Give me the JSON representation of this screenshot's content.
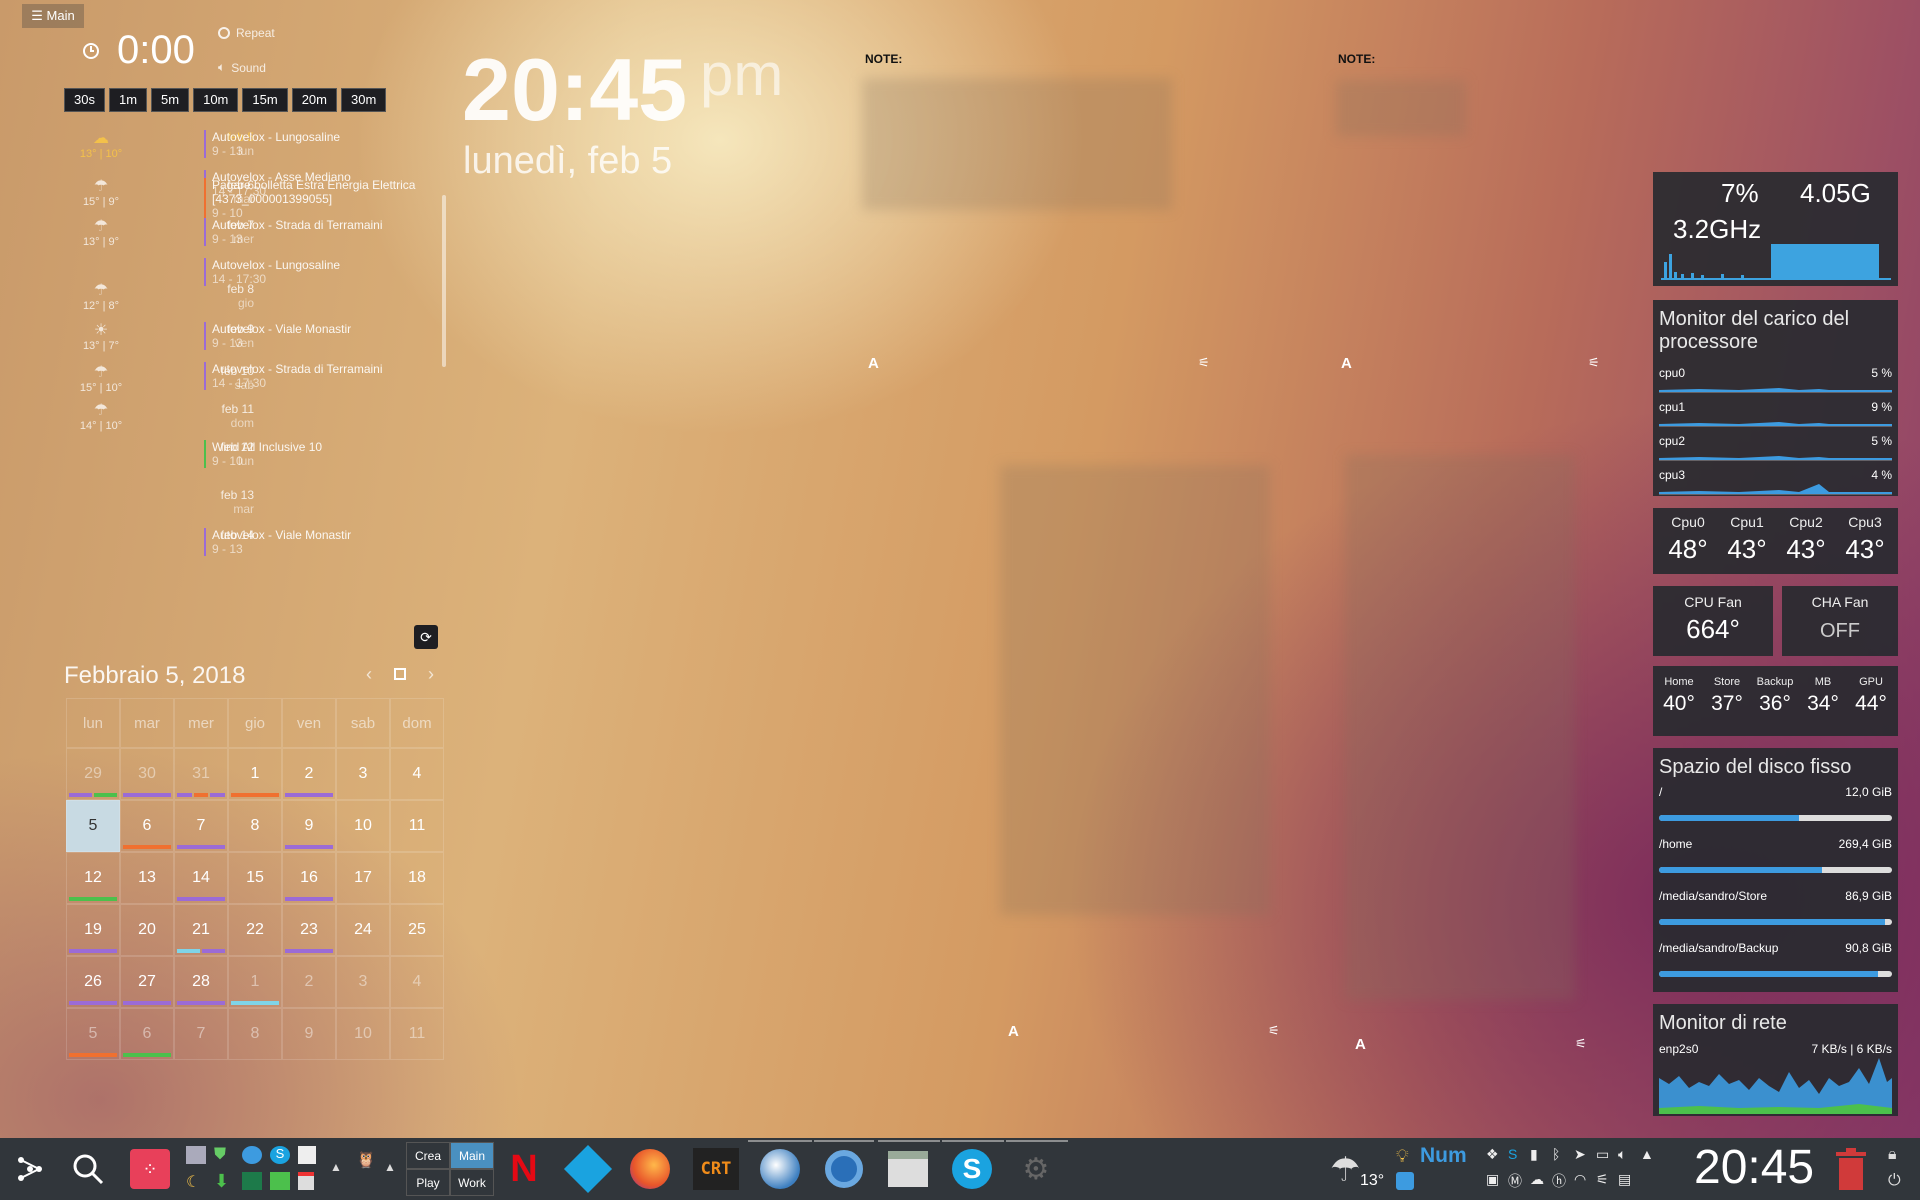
{
  "main_button": {
    "label": "☰ Main"
  },
  "timer": {
    "value": "0:00",
    "repeat_label": "Repeat",
    "sound_label": "Sound",
    "presets": [
      "30s",
      "1m",
      "5m",
      "10m",
      "15m",
      "20m",
      "30m"
    ]
  },
  "agenda": {
    "days": [
      {
        "date": "feb 5",
        "weekday": "lun",
        "weather": "13° | 10°",
        "icon": "cloud",
        "today": true,
        "events": [
          {
            "title": "Autovelox - Lungosaline",
            "time": "9 - 13",
            "color": "#9b6bd6"
          },
          {
            "title": "Autovelox - Asse Mediano",
            "time": "14 - 17:30",
            "color": "#9b6bd6"
          }
        ]
      },
      {
        "date": "feb 6",
        "weekday": "mar",
        "weather": "15° | 9°",
        "icon": "rain",
        "events": [
          {
            "title": "Pagare bolletta Estra Energia Elettrica [4373_000001399055]",
            "time": "9 - 10",
            "color": "#f07030"
          }
        ]
      },
      {
        "date": "feb 7",
        "weekday": "mer",
        "weather": "13° | 9°",
        "icon": "rain",
        "events": [
          {
            "title": "Autovelox - Strada di Terramaini",
            "time": "9 - 13",
            "color": "#9b6bd6"
          },
          {
            "title": "Autovelox - Lungosaline",
            "time": "14 - 17:30",
            "color": "#9b6bd6"
          }
        ]
      },
      {
        "date": "feb 8",
        "weekday": "gio",
        "weather": "12° | 8°",
        "icon": "rain",
        "events": []
      },
      {
        "date": "feb 9",
        "weekday": "ven",
        "weather": "13° | 7°",
        "icon": "sun",
        "events": [
          {
            "title": "Autovelox - Viale Monastir",
            "time": "9 - 13",
            "color": "#9b6bd6"
          },
          {
            "title": "Autovelox - Strada di Terramaini",
            "time": "14 - 17:30",
            "color": "#9b6bd6"
          }
        ]
      },
      {
        "date": "feb 10",
        "weekday": "sab",
        "weather": "15° | 10°",
        "icon": "rain",
        "events": []
      },
      {
        "date": "feb 11",
        "weekday": "dom",
        "weather": "14° | 10°",
        "icon": "rain",
        "events": []
      },
      {
        "date": "feb 12",
        "weekday": "lun",
        "weather": "",
        "icon": "",
        "events": [
          {
            "title": "Wind All Inclusive 10",
            "time": "9 - 10",
            "color": "#4cc04c"
          }
        ]
      },
      {
        "date": "feb 13",
        "weekday": "mar",
        "weather": "",
        "icon": "",
        "events": []
      },
      {
        "date": "feb 14",
        "weekday": "",
        "weather": "",
        "icon": "",
        "events": [
          {
            "title": "Autovelox - Viale Monastir",
            "time": "9 - 13",
            "color": "#9b6bd6"
          }
        ]
      }
    ]
  },
  "calendar": {
    "title": "Febbraio 5, 2018",
    "weekdays": [
      "lun",
      "mar",
      "mer",
      "gio",
      "ven",
      "sab",
      "dom"
    ],
    "weeks": [
      [
        {
          "d": "29",
          "o": true,
          "b": [
            "#9b6bd6",
            "#4cc04c"
          ]
        },
        {
          "d": "30",
          "o": true,
          "b": [
            "#9b6bd6"
          ]
        },
        {
          "d": "31",
          "o": true,
          "b": [
            "#9b6bd6",
            "#f07030",
            "#9b6bd6"
          ]
        },
        {
          "d": "1",
          "b": [
            "#f07030"
          ]
        },
        {
          "d": "2",
          "b": [
            "#9b6bd6"
          ]
        },
        {
          "d": "3"
        },
        {
          "d": "4"
        }
      ],
      [
        {
          "d": "5",
          "sel": true
        },
        {
          "d": "6",
          "b": [
            "#f07030"
          ]
        },
        {
          "d": "7",
          "b": [
            "#9b6bd6"
          ]
        },
        {
          "d": "8"
        },
        {
          "d": "9",
          "b": [
            "#9b6bd6"
          ]
        },
        {
          "d": "10"
        },
        {
          "d": "11"
        }
      ],
      [
        {
          "d": "12",
          "b": [
            "#4cc04c"
          ]
        },
        {
          "d": "13"
        },
        {
          "d": "14",
          "b": [
            "#9b6bd6"
          ]
        },
        {
          "d": "15"
        },
        {
          "d": "16",
          "b": [
            "#9b6bd6"
          ]
        },
        {
          "d": "17"
        },
        {
          "d": "18"
        }
      ],
      [
        {
          "d": "19",
          "b": [
            "#9b6bd6"
          ]
        },
        {
          "d": "20"
        },
        {
          "d": "21",
          "b": [
            "#7fd4e8",
            "#9b6bd6"
          ]
        },
        {
          "d": "22"
        },
        {
          "d": "23",
          "b": [
            "#9b6bd6"
          ]
        },
        {
          "d": "24"
        },
        {
          "d": "25"
        }
      ],
      [
        {
          "d": "26",
          "b": [
            "#9b6bd6"
          ]
        },
        {
          "d": "27",
          "b": [
            "#9b6bd6"
          ]
        },
        {
          "d": "28",
          "b": [
            "#9b6bd6"
          ]
        },
        {
          "d": "1",
          "o": true,
          "b": [
            "#7fd4e8"
          ]
        },
        {
          "d": "2",
          "o": true
        },
        {
          "d": "3",
          "o": true
        },
        {
          "d": "4",
          "o": true
        }
      ],
      [
        {
          "d": "5",
          "o": true,
          "b": [
            "#f07030"
          ]
        },
        {
          "d": "6",
          "o": true,
          "b": [
            "#4cc04c"
          ]
        },
        {
          "d": "7",
          "o": true
        },
        {
          "d": "8",
          "o": true
        },
        {
          "d": "9",
          "o": true
        },
        {
          "d": "10",
          "o": true
        },
        {
          "d": "11",
          "o": true
        }
      ]
    ]
  },
  "clock": {
    "time": "20:45",
    "ampm": "pm",
    "date": "lunedì, feb 5"
  },
  "notes": {
    "label": "NOTE:",
    "font_button": "A"
  },
  "system": {
    "cpu_percent": "7%",
    "ram": "4.05G",
    "freq": "3.2GHz",
    "load_title": "Monitor del carico del processore",
    "cores": [
      {
        "name": "cpu0",
        "value": "5 %"
      },
      {
        "name": "cpu1",
        "value": "9 %"
      },
      {
        "name": "cpu2",
        "value": "5 %"
      },
      {
        "name": "cpu3",
        "value": "4 %"
      }
    ],
    "core_temps": [
      {
        "name": "Cpu0",
        "value": "48°"
      },
      {
        "name": "Cpu1",
        "value": "43°"
      },
      {
        "name": "Cpu2",
        "value": "43°"
      },
      {
        "name": "Cpu3",
        "value": "43°"
      }
    ],
    "fans": [
      {
        "name": "CPU Fan",
        "value": "664°"
      },
      {
        "name": "CHA Fan",
        "value": "OFF"
      }
    ],
    "temps": [
      {
        "name": "Home",
        "value": "40°"
      },
      {
        "name": "Store",
        "value": "37°"
      },
      {
        "name": "Backup",
        "value": "36°"
      },
      {
        "name": "MB",
        "value": "34°"
      },
      {
        "name": "GPU",
        "value": "44°"
      }
    ],
    "disk_title": "Spazio del disco fisso",
    "disks": [
      {
        "name": "/",
        "value": "12,0 GiB",
        "fill": 0.6
      },
      {
        "name": "/home",
        "value": "269,4 GiB",
        "fill": 0.7
      },
      {
        "name": "/media/sandro/Store",
        "value": "86,9 GiB",
        "fill": 0.97
      },
      {
        "name": "/media/sandro/Backup",
        "value": "90,8 GiB",
        "fill": 0.94
      }
    ],
    "net_title": "Monitor di rete",
    "net_iface": "enp2s0",
    "net_rate": "7 KB/s | 6 KB/s"
  },
  "taskbar": {
    "activities": [
      "Crea",
      "Main",
      "Play",
      "Work"
    ],
    "weather_temp": "13°",
    "numlock": "Num",
    "clock": "20:45"
  },
  "colors": {
    "accent": "#3d9be0",
    "purple": "#9b6bd6",
    "orange": "#f07030",
    "green": "#4cc04c",
    "panel": "#2a2c30"
  }
}
